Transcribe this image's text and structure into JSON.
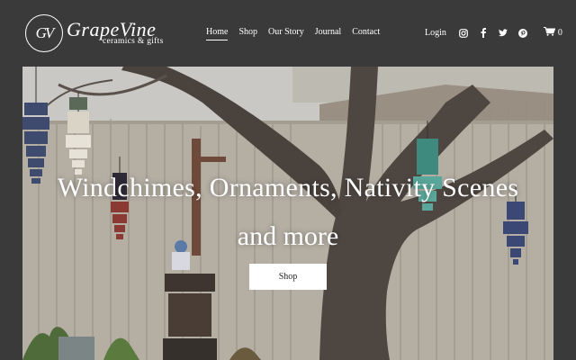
{
  "brand": {
    "monogram": "GV",
    "name": "GrapeVine",
    "tagline": "ceramics & gifts"
  },
  "nav": [
    {
      "label": "Home",
      "active": true
    },
    {
      "label": "Shop",
      "active": false
    },
    {
      "label": "Our Story",
      "active": false
    },
    {
      "label": "Journal",
      "active": false
    },
    {
      "label": "Contact",
      "active": false
    }
  ],
  "header_actions": {
    "login": "Login",
    "social_icons": [
      "instagram-icon",
      "facebook-icon",
      "twitter-icon",
      "pinterest-icon"
    ],
    "cart_icon": "cart-icon",
    "cart_count": "0"
  },
  "hero": {
    "headline_line1": "Windchimes, Ornaments, Nativity Scenes",
    "headline_line2": "and more",
    "button_label": "Shop"
  },
  "colors": {
    "header_bg": "#3a3a3a",
    "text": "#ffffff",
    "button_bg": "#ffffff",
    "button_text": "#222222"
  }
}
